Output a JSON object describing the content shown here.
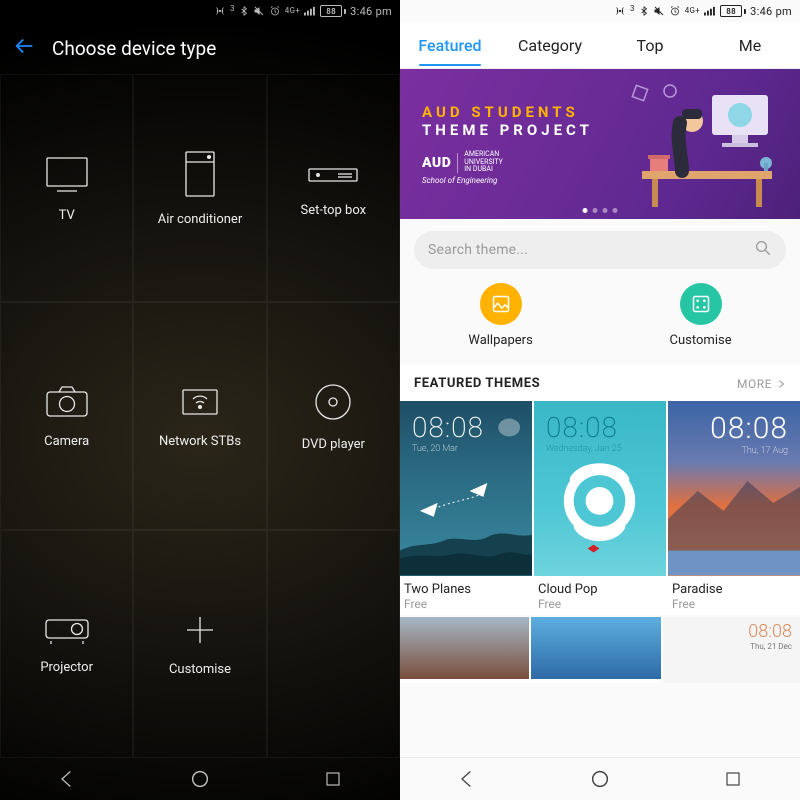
{
  "status": {
    "battery_text": "88",
    "clock": "3:46 pm"
  },
  "left": {
    "title": "Choose device type",
    "devices": [
      {
        "label": "TV"
      },
      {
        "label": "Air conditioner"
      },
      {
        "label": "Set-top box"
      },
      {
        "label": "Camera"
      },
      {
        "label": "Network STBs"
      },
      {
        "label": "DVD player"
      },
      {
        "label": "Projector"
      },
      {
        "label": "Customise"
      }
    ]
  },
  "right": {
    "tabs": [
      {
        "label": "Featured",
        "active": true
      },
      {
        "label": "Category",
        "active": false
      },
      {
        "label": "Top",
        "active": false
      },
      {
        "label": "Me",
        "active": false
      }
    ],
    "hero": {
      "line1": "AUD STUDENTS",
      "line2": "THEME PROJECT",
      "brand": "AUD",
      "brand_sub1": "AMERICAN\nUNIVERSITY\nIN DUBAI",
      "brand_sub2": "School of Engineering"
    },
    "search_placeholder": "Search theme...",
    "quick": [
      {
        "label": "Wallpapers"
      },
      {
        "label": "Customise"
      }
    ],
    "section_title": "FEATURED THEMES",
    "section_more": "MORE",
    "themes": [
      {
        "name": "Two Planes",
        "price": "Free",
        "clock": "08:08",
        "date": "Tue, 20 Mar"
      },
      {
        "name": "Cloud Pop",
        "price": "Free",
        "clock": "08:08",
        "date": "Wednesday, Jan 25"
      },
      {
        "name": "Paradise",
        "price": "Free",
        "clock": "08:08",
        "date": "Thu, 17 Aug"
      }
    ],
    "row2_clock": "08:08",
    "row2_date": "Thu, 21 Dec"
  }
}
